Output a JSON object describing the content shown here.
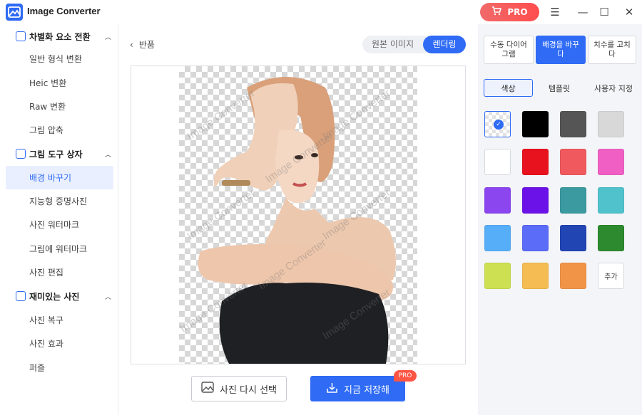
{
  "app": {
    "title": "Image Converter",
    "pro_label": "PRO"
  },
  "window_controls": {
    "menu": "☰",
    "minimize": "—",
    "maximize": "☐",
    "close": "✕"
  },
  "sidebar": {
    "sections": [
      {
        "title": "차별화 요소 전환",
        "items": [
          "일반 형식 변환",
          "Heic 변환",
          "Raw 변환",
          "그림 압축"
        ]
      },
      {
        "title": "그림 도구 상자",
        "items": [
          "배경 바꾸기",
          "지능형 증명사진",
          "사진 워터마크",
          "그림에 워터마크",
          "사진 편집"
        ]
      },
      {
        "title": "재미있는 사진",
        "items": [
          "사진 복구",
          "사진 효과",
          "퍼즐"
        ]
      }
    ],
    "active_item": "배경 바꾸기"
  },
  "main": {
    "back_label": "반품",
    "view_toggle": {
      "original": "원본 이미지",
      "rendered": "렌더링",
      "selected": "렌더링"
    },
    "watermark_text": "Image Converter",
    "reselect_label": "사진 다시 선택",
    "save_label": "지금 저장해",
    "save_badge": "PRO"
  },
  "rpanel": {
    "modes": [
      "수동 다이어그램",
      "배경을 바꾸다",
      "치수를 고치다"
    ],
    "active_mode": "배경을 바꾸다",
    "tabs": [
      "색상",
      "템플릿",
      "사용자 지정"
    ],
    "active_tab": "색상",
    "colors": [
      "transparent",
      "#000000",
      "#555555",
      "#d8d8d8",
      "#ffffff",
      "#e8121e",
      "#f05a5e",
      "#f060c4",
      "#8b46f0",
      "#6b12e8",
      "#3a9aa0",
      "#50c2cc",
      "#56aef8",
      "#5b6cf8",
      "#2245b4",
      "#2d8a2e",
      "#cde052",
      "#f4bc52",
      "#f29448"
    ],
    "selected_color": "transparent",
    "add_label": "추가"
  }
}
